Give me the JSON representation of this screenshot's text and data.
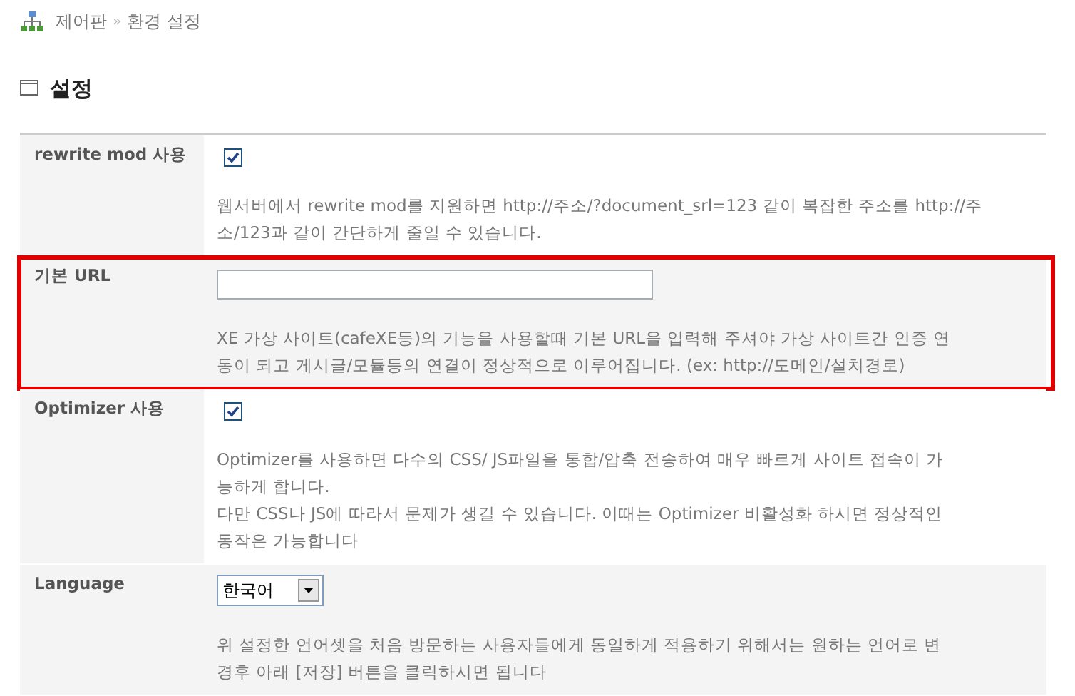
{
  "breadcrumb": [
    {
      "label": "제어판"
    },
    {
      "label": "환경 설정"
    }
  ],
  "breadcrumb_separator": "»",
  "page_title": "설정",
  "settings": [
    {
      "kind": "checkbox",
      "label": "rewrite mod 사용",
      "checked": true,
      "highlighted": false,
      "shaded": false,
      "description": [
        "웹서버에서 rewrite mod를 지원하면 http://주소/?document_srl=123 같이 복잡한 주소를 http://주",
        "소/123과 같이 간단하게 줄일 수 있습니다."
      ]
    },
    {
      "kind": "text",
      "label": "기본 URL",
      "highlighted": true,
      "shaded": true,
      "description": [
        "XE 가상 사이트(cafeXE등)의 기능을 사용할때 기본 URL을 입력해 주셔야 가상 사이트간 인증 연",
        "동이 되고 게시글/모듈등의 연결이 정상적으로 이루어집니다. (ex: http://도메인/설치경로)"
      ]
    },
    {
      "kind": "checkbox",
      "label": "Optimizer 사용",
      "checked": true,
      "highlighted": false,
      "shaded": false,
      "description": [
        "Optimizer를 사용하면 다수의 CSS/ JS파일을 통합/압축 전송하여 매우 빠르게 사이트 접속이 가",
        "능하게 합니다.",
        "다만 CSS나 JS에 따라서 문제가 생길 수 있습니다. 이때는 Optimizer 비활성화 하시면 정상적인",
        "동작은 가능합니다"
      ]
    },
    {
      "kind": "select",
      "label": "Language",
      "value": "한국어",
      "highlighted": false,
      "shaded": true,
      "description": [
        "위 설정한 언어셋을 처음 방문하는 사용자들에게 동일하게 적용하기 위해서는 원하는 언어로 변",
        "경후 아래 [저장] 버튼을 클릭하시면 됩니다"
      ]
    }
  ]
}
